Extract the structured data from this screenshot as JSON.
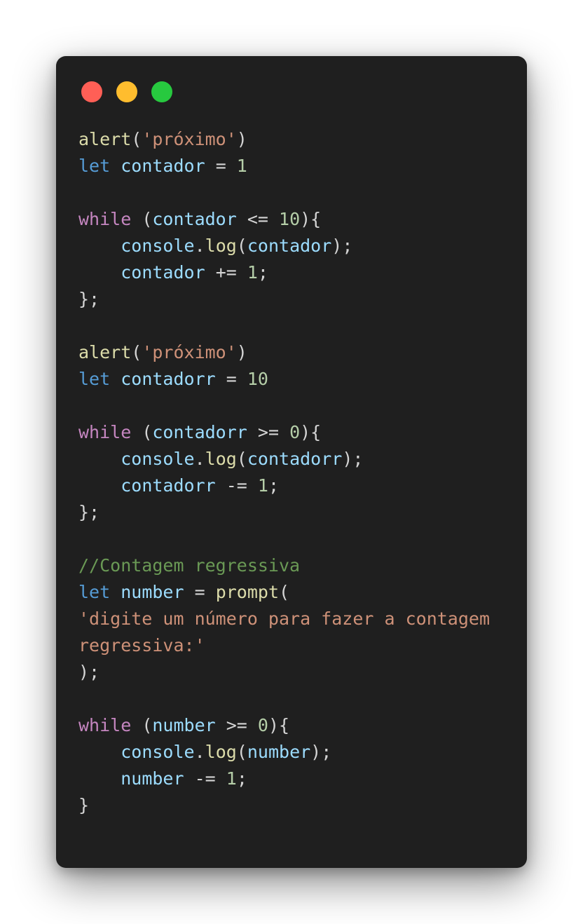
{
  "window": {
    "controls": [
      {
        "name": "close",
        "color": "#ff5f56"
      },
      {
        "name": "minimize",
        "color": "#ffbd2e"
      },
      {
        "name": "maximize",
        "color": "#27c93f"
      }
    ]
  },
  "colors": {
    "background": "#1f1f1f",
    "function": "#dcdcaa",
    "string": "#ce9178",
    "keyword_decl": "#569cd6",
    "keyword_ctrl": "#c586c0",
    "variable": "#9cdcfe",
    "number": "#b5cea8",
    "comment": "#6a9955",
    "punctuation": "#d4d4d4"
  },
  "code": {
    "lines": [
      [
        {
          "t": "fn",
          "v": "alert"
        },
        {
          "t": "punc",
          "v": "("
        },
        {
          "t": "str",
          "v": "'próximo'"
        },
        {
          "t": "punc",
          "v": ")"
        }
      ],
      [
        {
          "t": "kw-decl",
          "v": "let"
        },
        {
          "t": "punc",
          "v": " "
        },
        {
          "t": "var",
          "v": "contador"
        },
        {
          "t": "punc",
          "v": " = "
        },
        {
          "t": "num",
          "v": "1"
        }
      ],
      [],
      [
        {
          "t": "kw-ctrl",
          "v": "while"
        },
        {
          "t": "punc",
          "v": " ("
        },
        {
          "t": "var",
          "v": "contador"
        },
        {
          "t": "punc",
          "v": " <= "
        },
        {
          "t": "num",
          "v": "10"
        },
        {
          "t": "punc",
          "v": "){"
        }
      ],
      [
        {
          "t": "punc",
          "v": "    "
        },
        {
          "t": "var",
          "v": "console"
        },
        {
          "t": "punc",
          "v": "."
        },
        {
          "t": "fn",
          "v": "log"
        },
        {
          "t": "punc",
          "v": "("
        },
        {
          "t": "var",
          "v": "contador"
        },
        {
          "t": "punc",
          "v": ");"
        }
      ],
      [
        {
          "t": "punc",
          "v": "    "
        },
        {
          "t": "var",
          "v": "contador"
        },
        {
          "t": "punc",
          "v": " += "
        },
        {
          "t": "num",
          "v": "1"
        },
        {
          "t": "punc",
          "v": ";"
        }
      ],
      [
        {
          "t": "punc",
          "v": "};"
        }
      ],
      [],
      [
        {
          "t": "fn",
          "v": "alert"
        },
        {
          "t": "punc",
          "v": "("
        },
        {
          "t": "str",
          "v": "'próximo'"
        },
        {
          "t": "punc",
          "v": ")"
        }
      ],
      [
        {
          "t": "kw-decl",
          "v": "let"
        },
        {
          "t": "punc",
          "v": " "
        },
        {
          "t": "var",
          "v": "contadorr"
        },
        {
          "t": "punc",
          "v": " = "
        },
        {
          "t": "num",
          "v": "10"
        }
      ],
      [],
      [
        {
          "t": "kw-ctrl",
          "v": "while"
        },
        {
          "t": "punc",
          "v": " ("
        },
        {
          "t": "var",
          "v": "contadorr"
        },
        {
          "t": "punc",
          "v": " >= "
        },
        {
          "t": "num",
          "v": "0"
        },
        {
          "t": "punc",
          "v": "){"
        }
      ],
      [
        {
          "t": "punc",
          "v": "    "
        },
        {
          "t": "var",
          "v": "console"
        },
        {
          "t": "punc",
          "v": "."
        },
        {
          "t": "fn",
          "v": "log"
        },
        {
          "t": "punc",
          "v": "("
        },
        {
          "t": "var",
          "v": "contadorr"
        },
        {
          "t": "punc",
          "v": ");"
        }
      ],
      [
        {
          "t": "punc",
          "v": "    "
        },
        {
          "t": "var",
          "v": "contadorr"
        },
        {
          "t": "punc",
          "v": " -= "
        },
        {
          "t": "num",
          "v": "1"
        },
        {
          "t": "punc",
          "v": ";"
        }
      ],
      [
        {
          "t": "punc",
          "v": "};"
        }
      ],
      [],
      [
        {
          "t": "cmt",
          "v": "//Contagem regressiva"
        }
      ],
      [
        {
          "t": "kw-decl",
          "v": "let"
        },
        {
          "t": "punc",
          "v": " "
        },
        {
          "t": "var",
          "v": "number"
        },
        {
          "t": "punc",
          "v": " = "
        },
        {
          "t": "fn",
          "v": "prompt"
        },
        {
          "t": "punc",
          "v": "("
        }
      ],
      [
        {
          "t": "str",
          "v": "'digite um número para fazer a contagem"
        }
      ],
      [
        {
          "t": "str",
          "v": "regressiva:'"
        }
      ],
      [
        {
          "t": "punc",
          "v": ");"
        }
      ],
      [],
      [
        {
          "t": "kw-ctrl",
          "v": "while"
        },
        {
          "t": "punc",
          "v": " ("
        },
        {
          "t": "var",
          "v": "number"
        },
        {
          "t": "punc",
          "v": " >= "
        },
        {
          "t": "num",
          "v": "0"
        },
        {
          "t": "punc",
          "v": "){"
        }
      ],
      [
        {
          "t": "punc",
          "v": "    "
        },
        {
          "t": "var",
          "v": "console"
        },
        {
          "t": "punc",
          "v": "."
        },
        {
          "t": "fn",
          "v": "log"
        },
        {
          "t": "punc",
          "v": "("
        },
        {
          "t": "var",
          "v": "number"
        },
        {
          "t": "punc",
          "v": ");"
        }
      ],
      [
        {
          "t": "punc",
          "v": "    "
        },
        {
          "t": "var",
          "v": "number"
        },
        {
          "t": "punc",
          "v": " -= "
        },
        {
          "t": "num",
          "v": "1"
        },
        {
          "t": "punc",
          "v": ";"
        }
      ],
      [
        {
          "t": "punc",
          "v": "}"
        }
      ]
    ]
  }
}
